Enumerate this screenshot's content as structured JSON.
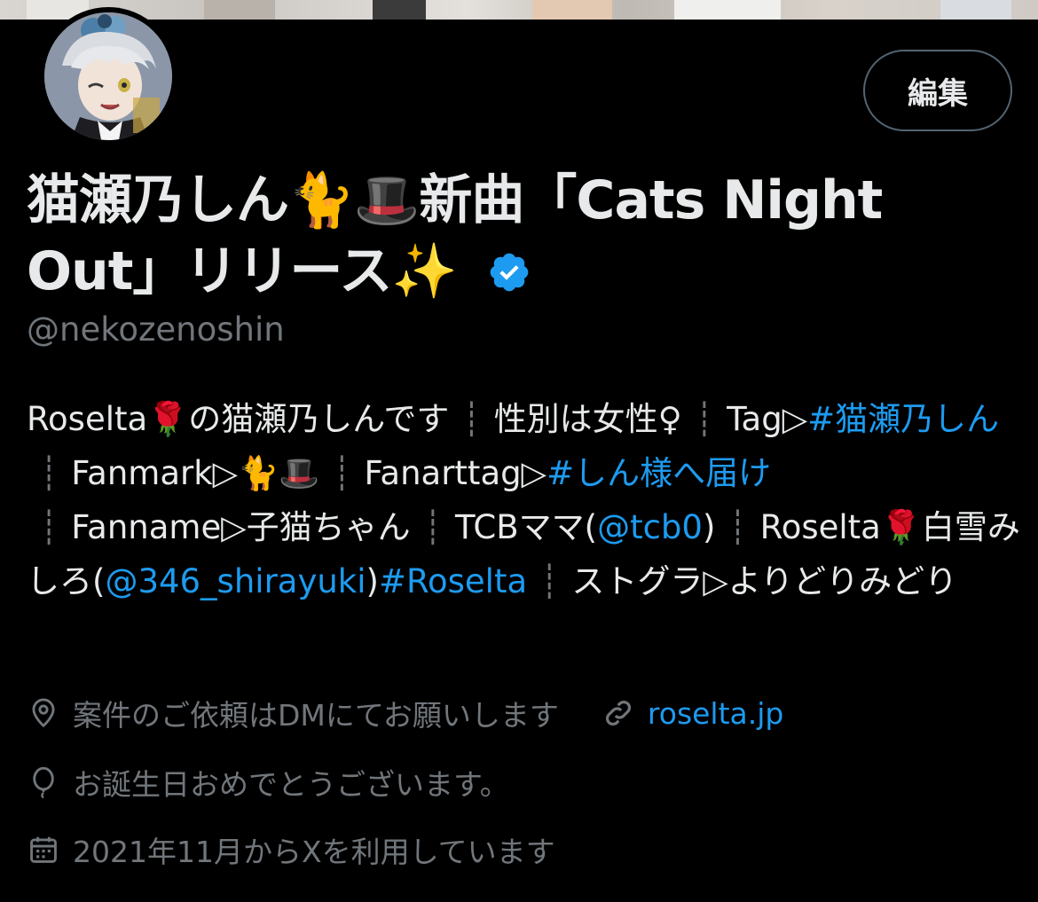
{
  "profile": {
    "display_name": "猫瀬乃しん🐈🎩新曲「Cats Night Out」リリース✨",
    "handle": "@nekozenoshin",
    "edit_label": "編集",
    "bio": {
      "p1": "Roselta🌹の猫瀬乃しんです",
      "p2": "性別は女性♀",
      "p3_prefix": "Tag▷",
      "p3_tag": "#猫瀬乃しん",
      "p4": "Fanmark▷🐈🎩",
      "p5_prefix": "Fanarttag▷",
      "p5_tag": "#しん様へ届け",
      "p6": "Fanname▷子猫ちゃん",
      "p7_prefix": "TCBママ(",
      "p7_mention": "@tcb0",
      "p7_suffix": ")",
      "p8_prefix": "Roselta🌹白雪みしろ(",
      "p8_mention": "@346_shirayuki",
      "p8_suffix": ")",
      "p8_tag": "#Roselta",
      "p9": "ストグラ▷よりどりみどり"
    },
    "location": "案件のご依頼はDMにてお願いします",
    "website": "roselta.jp",
    "birthday": "お誕生日おめでとうございます。",
    "joined": "2021年11月からXを利用しています"
  },
  "colors": {
    "accent": "#1d9bf0",
    "muted": "#71767b",
    "text": "#e7e9ea",
    "background": "#000000"
  },
  "icons": [
    "verified-badge-icon",
    "location-pin-icon",
    "link-icon",
    "balloon-icon",
    "calendar-icon"
  ]
}
